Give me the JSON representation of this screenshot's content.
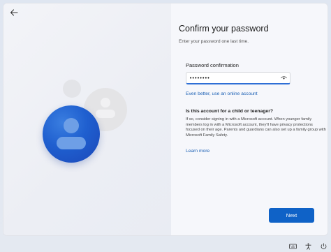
{
  "window": {
    "back_icon": "back-arrow-icon"
  },
  "form": {
    "title": "Confirm your password",
    "subtitle": "Enter your password one last time.",
    "field_label": "Password confirmation",
    "password_value": "••••••••",
    "reveal_icon": "eye-icon",
    "online_account_link": "Even better, use an online account",
    "question_heading": "Is this account for a child or teenager?",
    "question_body": "If so, consider signing in with a Microsoft account. When younger family members log in with a Microsoft account, they'll have privacy protections focused on their age. Parents and guardians can also set up a family group with Microsoft Family Safety.",
    "learn_more_link": "Learn more",
    "next_label": "Next"
  },
  "taskbar": {
    "icons": [
      "keyboard-icon",
      "accessibility-icon",
      "power-icon"
    ]
  },
  "colors": {
    "accent": "#0f62c7",
    "link": "#1a5fb4",
    "avatar": "#1f5fcf"
  }
}
